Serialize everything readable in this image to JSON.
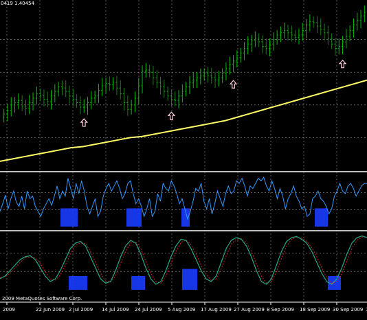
{
  "chart": {
    "symbol_info": "0419 1.40454",
    "copyright": "2009 MetaQuotes Software Corp.",
    "colors": {
      "background": "#000000",
      "grid": "#ffffff",
      "candle_bull": "#00c000",
      "candle_bear": "#1e7a1e",
      "moving_average": "#ffff66",
      "rsi": "#3399ff",
      "signal_box": "#1a3cff",
      "stoch_main": "#22aa88",
      "stoch_signal": "#cc2222",
      "arrow": "#ffccdd",
      "separator": "#ffffff"
    },
    "icons": [
      "up-arrow-icon"
    ],
    "x_axis_labels": [
      "2009",
      "22 Jun 2009",
      "2 Jul 2009",
      "14 Jul 2009",
      "24 Jul 2009",
      "5 Aug 2009",
      "17 Aug 2009",
      "27 Aug 2009",
      "8 Sep 2009",
      "18 Sep 2009",
      "30 Sep 2009",
      "12 Oct"
    ]
  },
  "chart_data": [
    {
      "type": "candlestick",
      "pane": "price",
      "close": [
        0.5,
        0.53,
        0.58,
        0.6,
        0.62,
        0.57,
        0.55,
        0.6,
        0.64,
        0.68,
        0.66,
        0.63,
        0.61,
        0.66,
        0.7,
        0.74,
        0.73,
        0.7,
        0.66,
        0.63,
        0.6,
        0.56,
        0.56,
        0.6,
        0.64,
        0.66,
        0.71,
        0.75,
        0.77,
        0.76,
        0.78,
        0.73,
        0.68,
        0.6,
        0.54,
        0.58,
        0.64,
        0.75,
        0.88,
        0.89,
        0.87,
        0.82,
        0.78,
        0.74,
        0.7,
        0.66,
        0.63,
        0.62,
        0.66,
        0.7,
        0.74,
        0.78,
        0.8,
        0.82,
        0.84,
        0.86,
        0.84,
        0.82,
        0.8,
        0.82,
        0.86,
        0.9,
        0.94,
        0.97,
        1.0,
        1.04,
        1.08,
        1.12,
        1.15,
        1.17,
        1.14,
        1.1,
        1.08,
        1.12,
        1.16,
        1.2,
        1.22,
        1.24,
        1.22,
        1.2,
        1.18,
        1.2,
        1.24,
        1.29,
        1.32,
        1.31,
        1.28,
        1.25,
        1.22,
        1.17,
        1.12,
        1.08,
        1.1,
        1.14,
        1.19,
        1.24,
        1.29,
        1.33,
        1.37,
        1.4
      ],
      "moving_average": [
        0.08,
        0.1,
        0.12,
        0.14,
        0.16,
        0.18,
        0.2,
        0.21,
        0.23,
        0.25,
        0.27,
        0.29,
        0.3,
        0.32,
        0.34,
        0.36,
        0.38,
        0.4,
        0.42,
        0.44,
        0.47,
        0.5,
        0.53,
        0.56,
        0.59,
        0.62,
        0.65,
        0.68,
        0.71,
        0.74,
        0.77,
        0.8
      ],
      "arrows_at_bar": [
        22,
        46,
        63,
        93
      ]
    },
    {
      "type": "line",
      "pane": "rsi",
      "values": [
        0.3,
        0.45,
        0.62,
        0.35,
        0.55,
        0.7,
        0.48,
        0.4,
        0.6,
        0.35,
        0.7,
        0.55,
        0.6,
        0.4,
        0.3,
        0.2,
        0.35,
        0.45,
        0.55,
        0.42,
        0.6,
        0.8,
        0.55,
        0.7,
        0.6,
        0.95,
        0.75,
        0.55,
        0.85,
        0.65,
        0.9,
        0.7,
        0.4,
        0.25,
        0.4,
        0.55,
        0.2,
        0.3,
        0.6,
        0.75,
        0.85,
        0.7,
        0.8,
        0.9,
        0.75,
        0.55,
        0.65,
        0.85,
        0.9,
        0.65,
        0.45,
        0.55,
        0.4,
        0.2,
        0.35,
        0.55,
        0.2,
        0.3,
        0.65,
        0.5,
        0.85,
        0.75,
        0.7,
        0.9,
        0.8,
        0.65,
        0.45,
        0.55,
        0.35,
        0.15,
        0.3,
        0.5,
        0.75,
        0.7,
        0.85,
        0.5,
        0.35,
        0.55,
        0.25,
        0.45,
        0.7,
        0.55,
        0.4,
        0.65,
        0.8,
        0.65,
        0.7,
        0.9,
        0.85,
        0.95,
        0.8,
        0.6,
        0.8,
        0.75,
        0.85,
        0.95,
        0.9,
        0.97,
        0.8,
        0.7,
        0.9,
        0.75,
        0.55,
        0.75,
        0.6,
        0.35,
        0.55,
        0.65,
        0.8,
        0.6,
        0.5,
        0.35,
        0.4,
        0.2,
        0.25,
        0.55,
        0.6,
        0.7,
        0.55,
        0.5,
        0.4,
        0.25,
        0.35,
        0.6,
        0.7,
        0.85,
        0.7,
        0.65,
        0.8,
        0.85,
        0.75,
        0.6,
        0.7,
        0.8,
        0.85,
        0.85
      ]
    },
    {
      "type": "line",
      "pane": "stochastic",
      "main": [
        0.2,
        0.25,
        0.35,
        0.45,
        0.55,
        0.6,
        0.62,
        0.55,
        0.4,
        0.25,
        0.15,
        0.2,
        0.35,
        0.55,
        0.75,
        0.85,
        0.88,
        0.8,
        0.6,
        0.4,
        0.2,
        0.12,
        0.15,
        0.35,
        0.6,
        0.8,
        0.9,
        0.85,
        0.65,
        0.4,
        0.2,
        0.1,
        0.15,
        0.35,
        0.6,
        0.8,
        0.92,
        0.9,
        0.75,
        0.55,
        0.35,
        0.2,
        0.15,
        0.25,
        0.5,
        0.75,
        0.9,
        0.95,
        0.92,
        0.8,
        0.6,
        0.35,
        0.15,
        0.1,
        0.2,
        0.45,
        0.7,
        0.88,
        0.95,
        0.97,
        0.92,
        0.85,
        0.7,
        0.5,
        0.3,
        0.15,
        0.1,
        0.2,
        0.4,
        0.65,
        0.85,
        0.95,
        0.98,
        0.95
      ],
      "signal": [
        0.22,
        0.24,
        0.3,
        0.4,
        0.5,
        0.58,
        0.6,
        0.58,
        0.48,
        0.33,
        0.2,
        0.17,
        0.27,
        0.45,
        0.65,
        0.8,
        0.86,
        0.84,
        0.7,
        0.5,
        0.3,
        0.16,
        0.14,
        0.26,
        0.48,
        0.7,
        0.85,
        0.87,
        0.75,
        0.52,
        0.3,
        0.15,
        0.12,
        0.25,
        0.48,
        0.7,
        0.86,
        0.91,
        0.82,
        0.65,
        0.45,
        0.28,
        0.17,
        0.2,
        0.38,
        0.62,
        0.83,
        0.92,
        0.93,
        0.86,
        0.7,
        0.47,
        0.25,
        0.12,
        0.15,
        0.33,
        0.58,
        0.79,
        0.92,
        0.96,
        0.94,
        0.88,
        0.77,
        0.6,
        0.4,
        0.22,
        0.12,
        0.15,
        0.3,
        0.52,
        0.75,
        0.9,
        0.96,
        0.96
      ]
    }
  ]
}
